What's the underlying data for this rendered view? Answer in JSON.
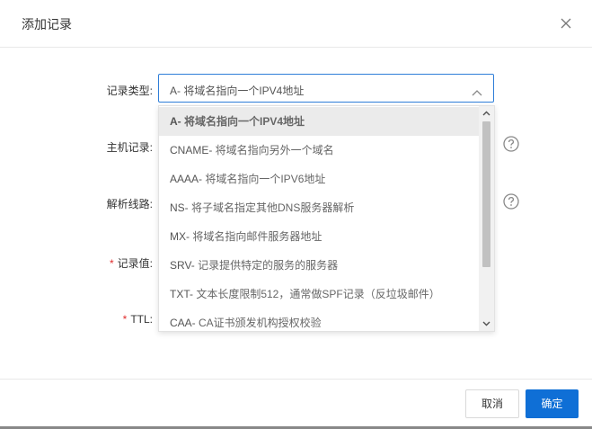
{
  "dialog": {
    "title": "添加记录",
    "close_icon": "close-icon"
  },
  "form": {
    "record_type_label": "记录类型:",
    "host_label": "主机记录:",
    "line_label": "解析线路:",
    "value_label": "记录值:",
    "ttl_label": "TTL:",
    "required_mark": "*",
    "record_type_value": "A- 将域名指向一个IPV4地址",
    "help_icon": "question-circle-icon",
    "arrow_icon": "chevron-up-icon"
  },
  "dropdown": {
    "options": [
      {
        "code": "A-",
        "desc": " 将域名指向一个IPV4地址",
        "selected": true
      },
      {
        "code": "CNAME-",
        "desc": " 将域名指向另外一个域名",
        "selected": false
      },
      {
        "code": "AAAA-",
        "desc": " 将域名指向一个IPV6地址",
        "selected": false
      },
      {
        "code": "NS-",
        "desc": " 将子域名指定其他DNS服务器解析",
        "selected": false
      },
      {
        "code": "MX-",
        "desc": " 将域名指向邮件服务器地址",
        "selected": false
      },
      {
        "code": "SRV-",
        "desc": " 记录提供特定的服务的服务器",
        "selected": false
      },
      {
        "code": "TXT-",
        "desc": " 文本长度限制512，通常做SPF记录（反垃圾邮件）",
        "selected": false
      },
      {
        "code": "CAA-",
        "desc": " CA证书颁发机构授权校验",
        "selected": false
      }
    ]
  },
  "footer": {
    "cancel_label": "取消",
    "ok_label": "确定"
  },
  "colors": {
    "accent": "#0f6fd6",
    "required": "#e02d2d",
    "focus_border": "#2f7ed8"
  }
}
